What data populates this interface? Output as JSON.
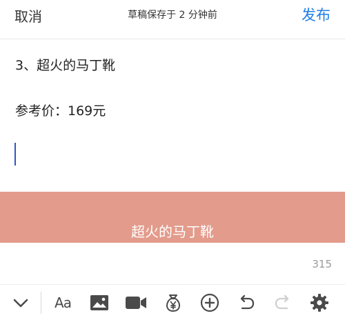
{
  "header": {
    "cancel_label": "取消",
    "draft_status": "草稿保存于 2 分钟前",
    "publish_label": "发布",
    "accent_color": "#1f7ee6"
  },
  "editor": {
    "lines": [
      "3、超火的马丁靴",
      "参考价：169元"
    ],
    "image_caption": "超火的马丁靴",
    "image_color": "#e39b8b",
    "word_count": "315"
  },
  "toolbar": {
    "font_label": "Aa",
    "icons": [
      "chevron-down-icon",
      "font-style-icon",
      "image-icon",
      "video-icon",
      "money-bag-icon",
      "add-icon",
      "undo-icon",
      "redo-icon",
      "settings-icon"
    ]
  }
}
